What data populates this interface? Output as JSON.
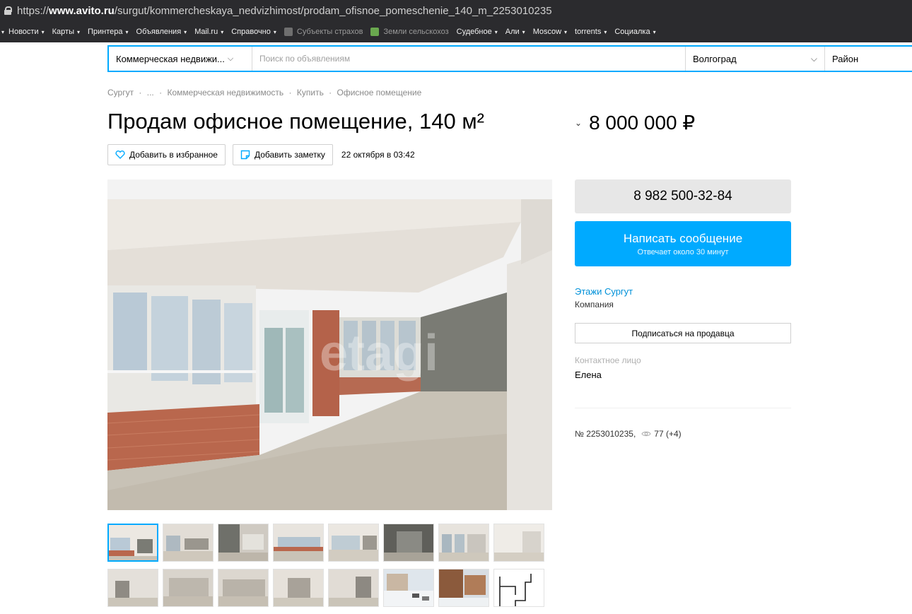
{
  "browser": {
    "url_prefix": "https://",
    "url_host": "www.avito.ru",
    "url_path": "/surgut/kommercheskaya_nedvizhimost/prodam_ofisnoe_pomeschenie_140_m_2253010235"
  },
  "bookmarks": [
    {
      "label": "Новости"
    },
    {
      "label": "Карты"
    },
    {
      "label": "Принтера"
    },
    {
      "label": "Объявления"
    },
    {
      "label": "Mail.ru"
    },
    {
      "label": "Справочно"
    },
    {
      "label": "Субъекты страхов"
    },
    {
      "label": "Земли сельскохоз"
    },
    {
      "label": "Судебное"
    },
    {
      "label": "Али"
    },
    {
      "label": "Moscow"
    },
    {
      "label": "torrents"
    },
    {
      "label": "Социалка"
    }
  ],
  "search": {
    "category": "Коммерческая недвижи...",
    "placeholder": "Поиск по объявлениям",
    "city": "Волгоград",
    "district": "Район"
  },
  "breadcrumbs": [
    "Сургут",
    "·",
    "...",
    "·",
    "Коммерческая недвижимость",
    "·",
    "Купить",
    "·",
    "Офисное помещение"
  ],
  "listing": {
    "title": "Продам офисное помещение, 140 м²",
    "price": "8 000 000 ₽",
    "favorite_label": "Добавить в избранное",
    "note_label": "Добавить заметку",
    "date": "22 октября в 03:42"
  },
  "contact": {
    "phone": "8 982 500-32-84",
    "write_label": "Написать сообщение",
    "write_sub": "Отвечает около 30 минут",
    "seller_name": "Этажи Сургут",
    "seller_type": "Компания",
    "subscribe_label": "Подписаться на продавца",
    "contact_label": "Контактное лицо",
    "contact_name": "Елена"
  },
  "meta": {
    "ad_number": "№ 2253010235,",
    "views": "77 (+4)"
  },
  "colors": {
    "accent": "#00aaff",
    "link": "#0091d9",
    "browser_bar": "#2b2b2e"
  }
}
